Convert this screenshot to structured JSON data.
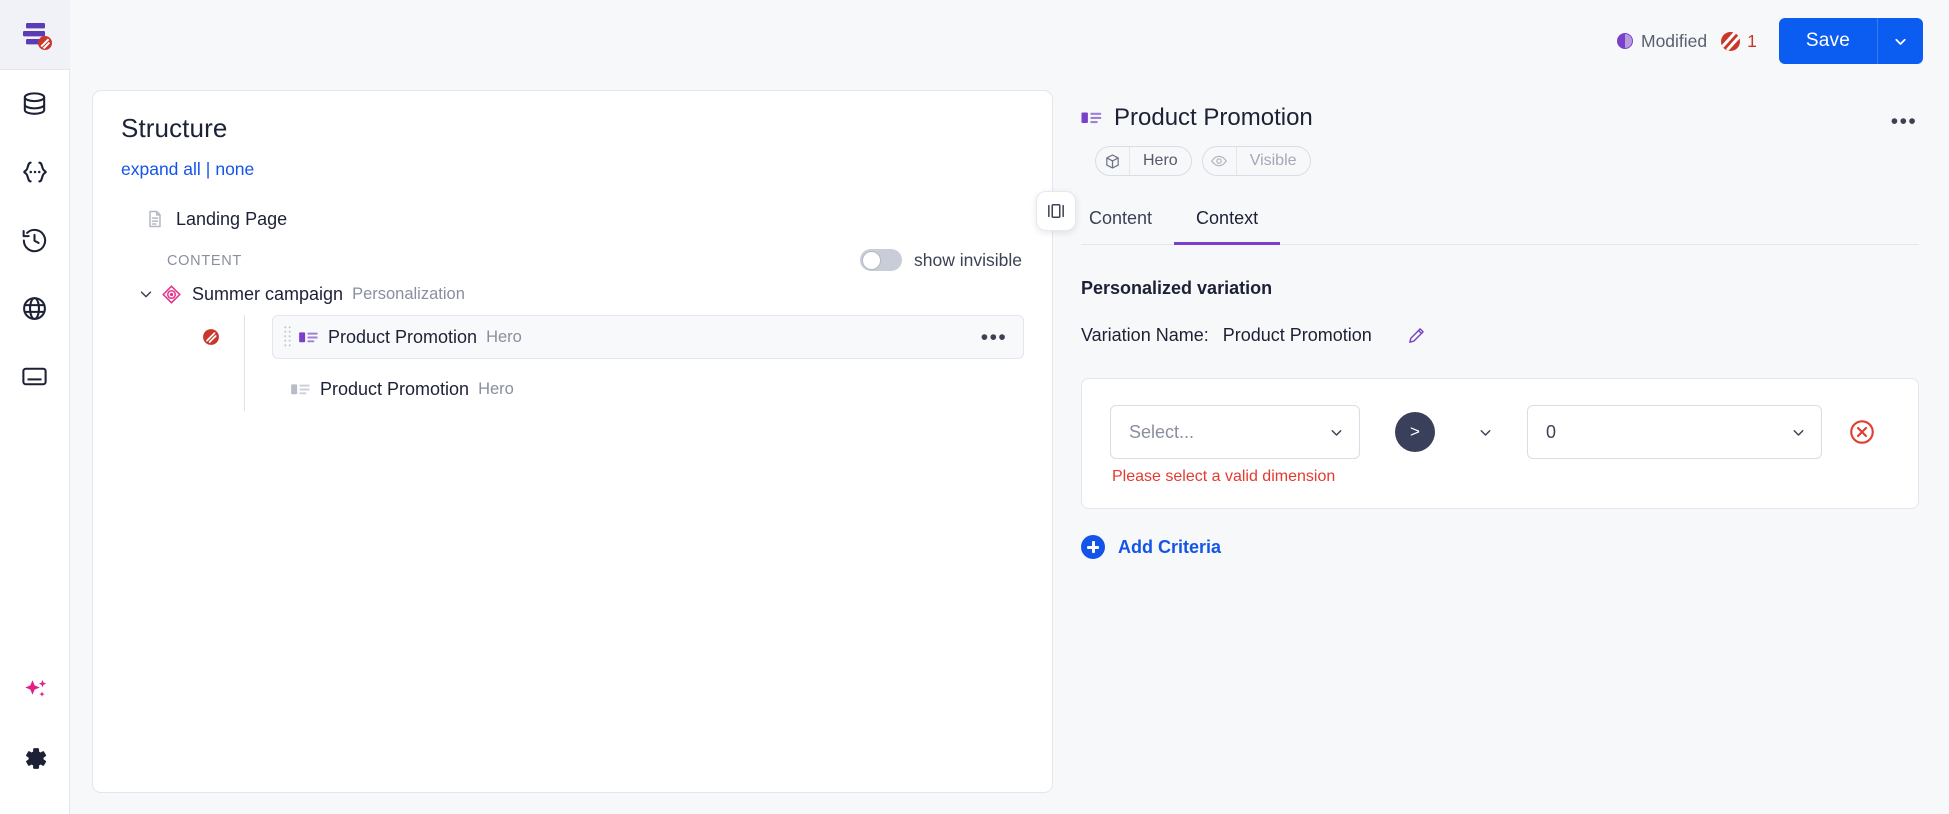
{
  "sidebar": {
    "logo": {
      "name": "app-logo"
    },
    "items": [
      {
        "id": "database",
        "icon": "database-icon"
      },
      {
        "id": "code",
        "icon": "braces-code-icon"
      },
      {
        "id": "history",
        "icon": "history-clock-icon"
      },
      {
        "id": "globe",
        "icon": "globe-icon"
      },
      {
        "id": "page",
        "icon": "window-card-icon"
      }
    ],
    "bottom_items": [
      {
        "id": "ai",
        "icon": "sparkles-icon"
      },
      {
        "id": "settings",
        "icon": "gear-icon"
      }
    ]
  },
  "topbar": {
    "status_label": "Modified",
    "status_icon": "half-circle-icon",
    "conflict_icon": "slashed-circle-icon",
    "conflict_count": "1",
    "save_label": "Save",
    "save_caret_icon": "chevron-down-icon",
    "accent_blue": "#0b5cf0",
    "conflict_red": "#c9362c",
    "modified_purple": "#7b40c9"
  },
  "structure": {
    "title": "Structure",
    "expand_all_label": "expand all",
    "separator": "|",
    "none_label": "none",
    "toggle_label": "show invisible",
    "toggle_on": false,
    "panel_toggle_icon": "split-panel-icon",
    "tree": {
      "page": {
        "label": "Landing Page",
        "icon": "document-icon"
      },
      "section_label": "CONTENT",
      "campaign": {
        "label": "Summer campaign",
        "sub": "Personalization",
        "icon": "target-icon",
        "chevron": "chevron-down-icon",
        "expanded": true
      },
      "children": [
        {
          "label": "Product Promotion",
          "sub": "Hero",
          "icon": "hero-block-icon",
          "selected": true,
          "conflict": true,
          "menu_icon": "ellipsis-icon"
        },
        {
          "label": "Product Promotion",
          "sub": "Hero",
          "icon": "hero-block-icon",
          "selected": false,
          "conflict": false
        }
      ]
    }
  },
  "detail": {
    "title": "Product Promotion",
    "title_icon": "hero-block-icon",
    "menu_icon": "ellipsis-icon",
    "badges": [
      {
        "label": "Hero",
        "icon": "cube-icon",
        "muted": false
      },
      {
        "label": "Visible",
        "icon": "eye-icon",
        "muted": true
      }
    ],
    "tabs": [
      {
        "label": "Content",
        "active": false
      },
      {
        "label": "Context",
        "active": true
      }
    ],
    "section_title": "Personalized variation",
    "variation": {
      "label": "Variation Name:",
      "value": "Product Promotion",
      "edit_icon": "pencil-icon"
    },
    "criteria": [
      {
        "dimension_placeholder": "Select...",
        "dimension_value": "",
        "dimension_caret": "chevron-down-icon",
        "operator_symbol": ">",
        "operator_caret": "chevron-down-icon",
        "value": "0",
        "value_caret": "chevron-down-icon",
        "remove_icon": "remove-circle-icon",
        "error": "Please select a valid dimension"
      }
    ],
    "add_criteria_label": "Add Criteria",
    "active_tab_color": "#7b40c9",
    "error_color": "#e33b30",
    "link_color": "#1454e8"
  }
}
